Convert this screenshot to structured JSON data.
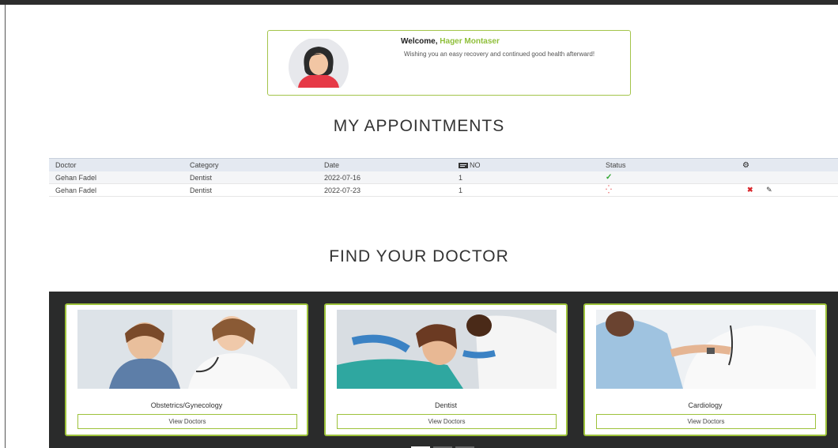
{
  "welcome": {
    "greeting": "Welcome,",
    "user_name": "Hager Montaser",
    "message": "Wishing you an easy recovery and continued good health afterward!"
  },
  "appointments": {
    "title": "MY APPOINTMENTS",
    "columns": [
      "Doctor",
      "Category",
      "Date",
      "NO",
      "Status"
    ],
    "settings_icon": "gear-icon",
    "rows": [
      {
        "doctor": "Gehan Fadel",
        "category": "Dentist",
        "date": "2022-07-16",
        "no": "1",
        "status": "done",
        "status_glyph": "✓"
      },
      {
        "doctor": "Gehan Fadel",
        "category": "Dentist",
        "date": "2022-07-23",
        "no": "1",
        "status": "pending",
        "status_glyph": "⁛"
      }
    ]
  },
  "find_doctor": {
    "title": "FIND YOUR DOCTOR",
    "cards": [
      {
        "category": "Obstetrics/Gynecology",
        "button": "View Doctors"
      },
      {
        "category": "Dentist",
        "button": "View Doctors"
      },
      {
        "category": "Cardiology",
        "button": "View Doctors"
      }
    ],
    "active_slide": 1,
    "slide_count": 3
  },
  "colors": {
    "accent": "#9dc23a",
    "name_green": "#8fbf3a",
    "carousel_bg": "#2a2b2b",
    "table_header": "#e4e9f1",
    "status_ok": "#2fa52f",
    "status_cancel": "#d9262b"
  }
}
